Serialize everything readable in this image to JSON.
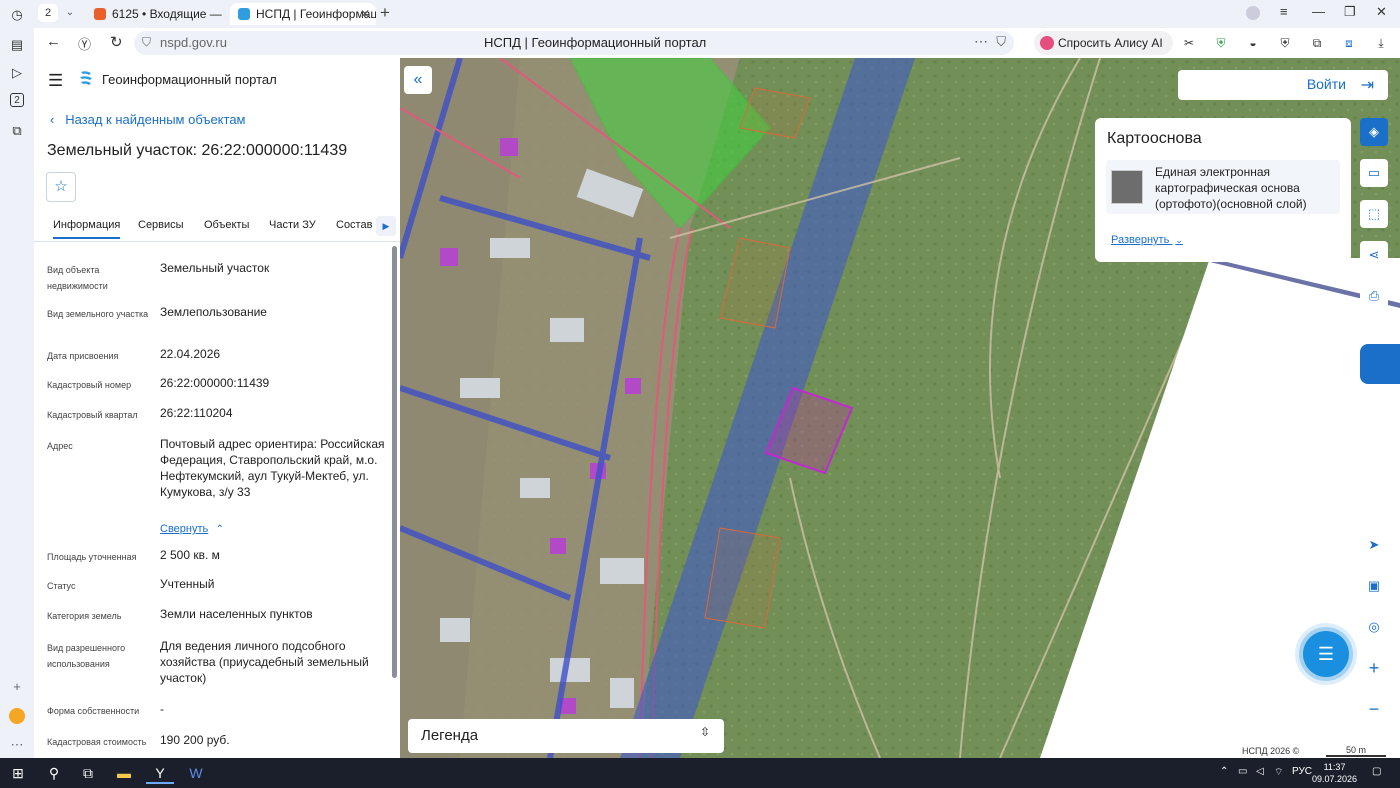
{
  "browser": {
    "tab_count": "2",
    "tabs": [
      {
        "label": "6125 • Входящие — Яндек",
        "color": "#e8602c"
      },
      {
        "label": "НСПД | Геоинформацио",
        "color": "#2f9de0"
      }
    ],
    "url": "nspd.gov.ru",
    "page_title": "НСПД | Геоинформационный портал",
    "alice_label": "Спросить Алису AI"
  },
  "panel": {
    "portal_name": "Геоинформационный портал",
    "back_label": "Назад к найденным объектам",
    "title": "Земельный участок: 26:22:000000:11439",
    "tabs": [
      "Информация",
      "Сервисы",
      "Объекты",
      "Части ЗУ",
      "Состав"
    ],
    "fields": [
      {
        "label": "Вид объекта недвижимости",
        "value": "Земельный участок"
      },
      {
        "label": "Вид земельного участка",
        "value": "Землепользование"
      },
      {
        "label": "Дата присвоения",
        "value": "22.04.2026"
      },
      {
        "label": "Кадастровый номер",
        "value": "26:22:000000:11439"
      },
      {
        "label": "Кадастровый квартал",
        "value": "26:22:110204"
      },
      {
        "label": "Адрес",
        "value": "Почтовый адрес ориентира: Российская Федерация, Ставропольский край, м.о. Нефтекумский, аул Тукуй-Мектеб, ул. Кумукова, з/у 33"
      },
      {
        "label": "Площадь уточненная",
        "value": "2 500 кв. м"
      },
      {
        "label": "Статус",
        "value": "Учтенный"
      },
      {
        "label": "Категория земель",
        "value": "Земли населенных пунктов"
      },
      {
        "label": "Вид разрешенного использования",
        "value": "Для ведения личного подсобного хозяйства (приусадебный земельный участок)"
      },
      {
        "label": "Форма собственности",
        "value": "-"
      },
      {
        "label": "Кадастровая стоимость",
        "value": "190 200 руб."
      }
    ],
    "collapse_label": "Свернуть"
  },
  "map": {
    "login_label": "Войти",
    "basemap": {
      "title": "Картооснова",
      "layer": "Единая электронная картографическая основа (ортофото)(основной слой)",
      "expand_label": "Развернуть"
    },
    "legend_label": "Легенда",
    "copyright": "НСПД 2026 ©",
    "scale": "50 m"
  },
  "taskbar": {
    "lang": "РУС",
    "time": "11:37",
    "date": "09.07.2026"
  }
}
